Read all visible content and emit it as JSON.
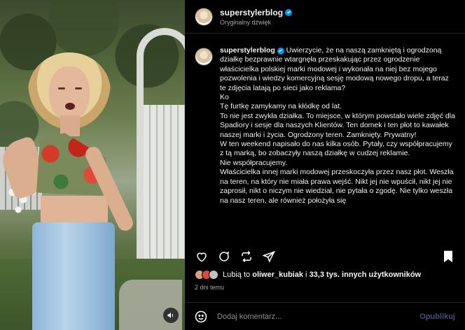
{
  "header": {
    "username": "superstylerblog",
    "subtitle": "Oryginalny dźwięk"
  },
  "caption": {
    "author": "superstylerblog",
    "lines": [
      "Uwierzycie, że na naszą zamkniętą i ogrodzoną działkę bezprawnie wtargnęła przeskakując przez ogrodzenie właścicielka polskiej marki modowej i wykonała na niej bez mojego pozwolenia i wiedzy komercyjną sesję modową nowego dropu, a teraz te zdjęcia latają po sieci jako reklama?",
      "Ko",
      "Tę furtkę zamykamy na kłódkę od lat.",
      "To nie jest zwykła działka. To miejsce, w którym powstało wiele zdjęć dla Spadiory i sesje dla naszych Klientów. Ten domek i ten płot to kawałek naszej marki i życia. Ogrodzony teren. Zamknięty. Prywatny!",
      "W ten weekend napisało do nas kilka osób. Pytały, czy współpracujemy z tą marką, bo zobaczyły naszą działkę w cudzej reklamie.",
      "Nie współpracujemy.",
      "Właścicielka innej marki modowej przeskoczyła przez nasz płot. Weszła na teren, na który nie miała prawa wejść. Nikt jej nie wpuścił, nikt jej nie zaprosił, nikt o niczym nie wiedział, nie pytała o zgodę. Nie tylko weszła na nasz teren, ale również położyła się"
    ]
  },
  "likes": {
    "prefix": "Lubią to",
    "user": "oliwer_kubiak",
    "middle": "i",
    "others": "33,3 tys. innych użytkowników"
  },
  "time": "2 dni temu",
  "comment_box": {
    "placeholder": "Dodaj komentarz...",
    "post_label": "Opublikuj"
  },
  "icons": [
    "verified-badge-icon",
    "heart-icon",
    "comment-icon",
    "repost-icon",
    "share-icon",
    "bookmark-icon",
    "emoji-icon",
    "sound-icon"
  ],
  "colors": {
    "verified": "#0095f6",
    "post_disabled": "#4b4f7a"
  }
}
